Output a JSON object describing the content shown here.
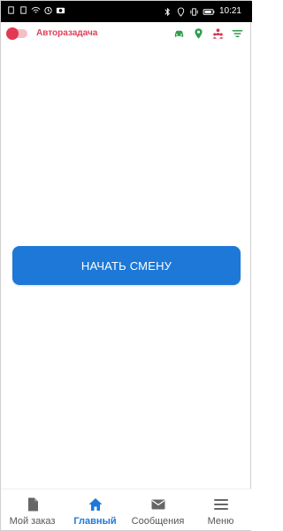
{
  "statusbar": {
    "time": "10:21",
    "icons_left": [
      "sim-icon",
      "sim-icon",
      "wifi-icon",
      "alarm-icon",
      "camera-icon"
    ],
    "icons_right": [
      "bluetooth-icon",
      "location-icon",
      "vibrate-icon",
      "battery-icon"
    ]
  },
  "header": {
    "title": "Авторазадача",
    "toggle_color": "#e33a52",
    "icons": [
      "car-icon",
      "location-pin-icon",
      "people-icon",
      "filter-icon"
    ]
  },
  "main": {
    "start_button_label": "НАЧАТЬ СМЕНУ"
  },
  "bottom_nav": {
    "items": [
      {
        "label": "Мой заказ",
        "icon": "document-icon",
        "active": false
      },
      {
        "label": "Главный",
        "icon": "home-icon",
        "active": true
      },
      {
        "label": "Сообщения",
        "icon": "mail-icon",
        "active": false
      },
      {
        "label": "Меню",
        "icon": "menu-icon",
        "active": false
      }
    ]
  },
  "colors": {
    "accent": "#1d78d7",
    "brand_red": "#e13e57",
    "green": "#2e9e4b"
  }
}
